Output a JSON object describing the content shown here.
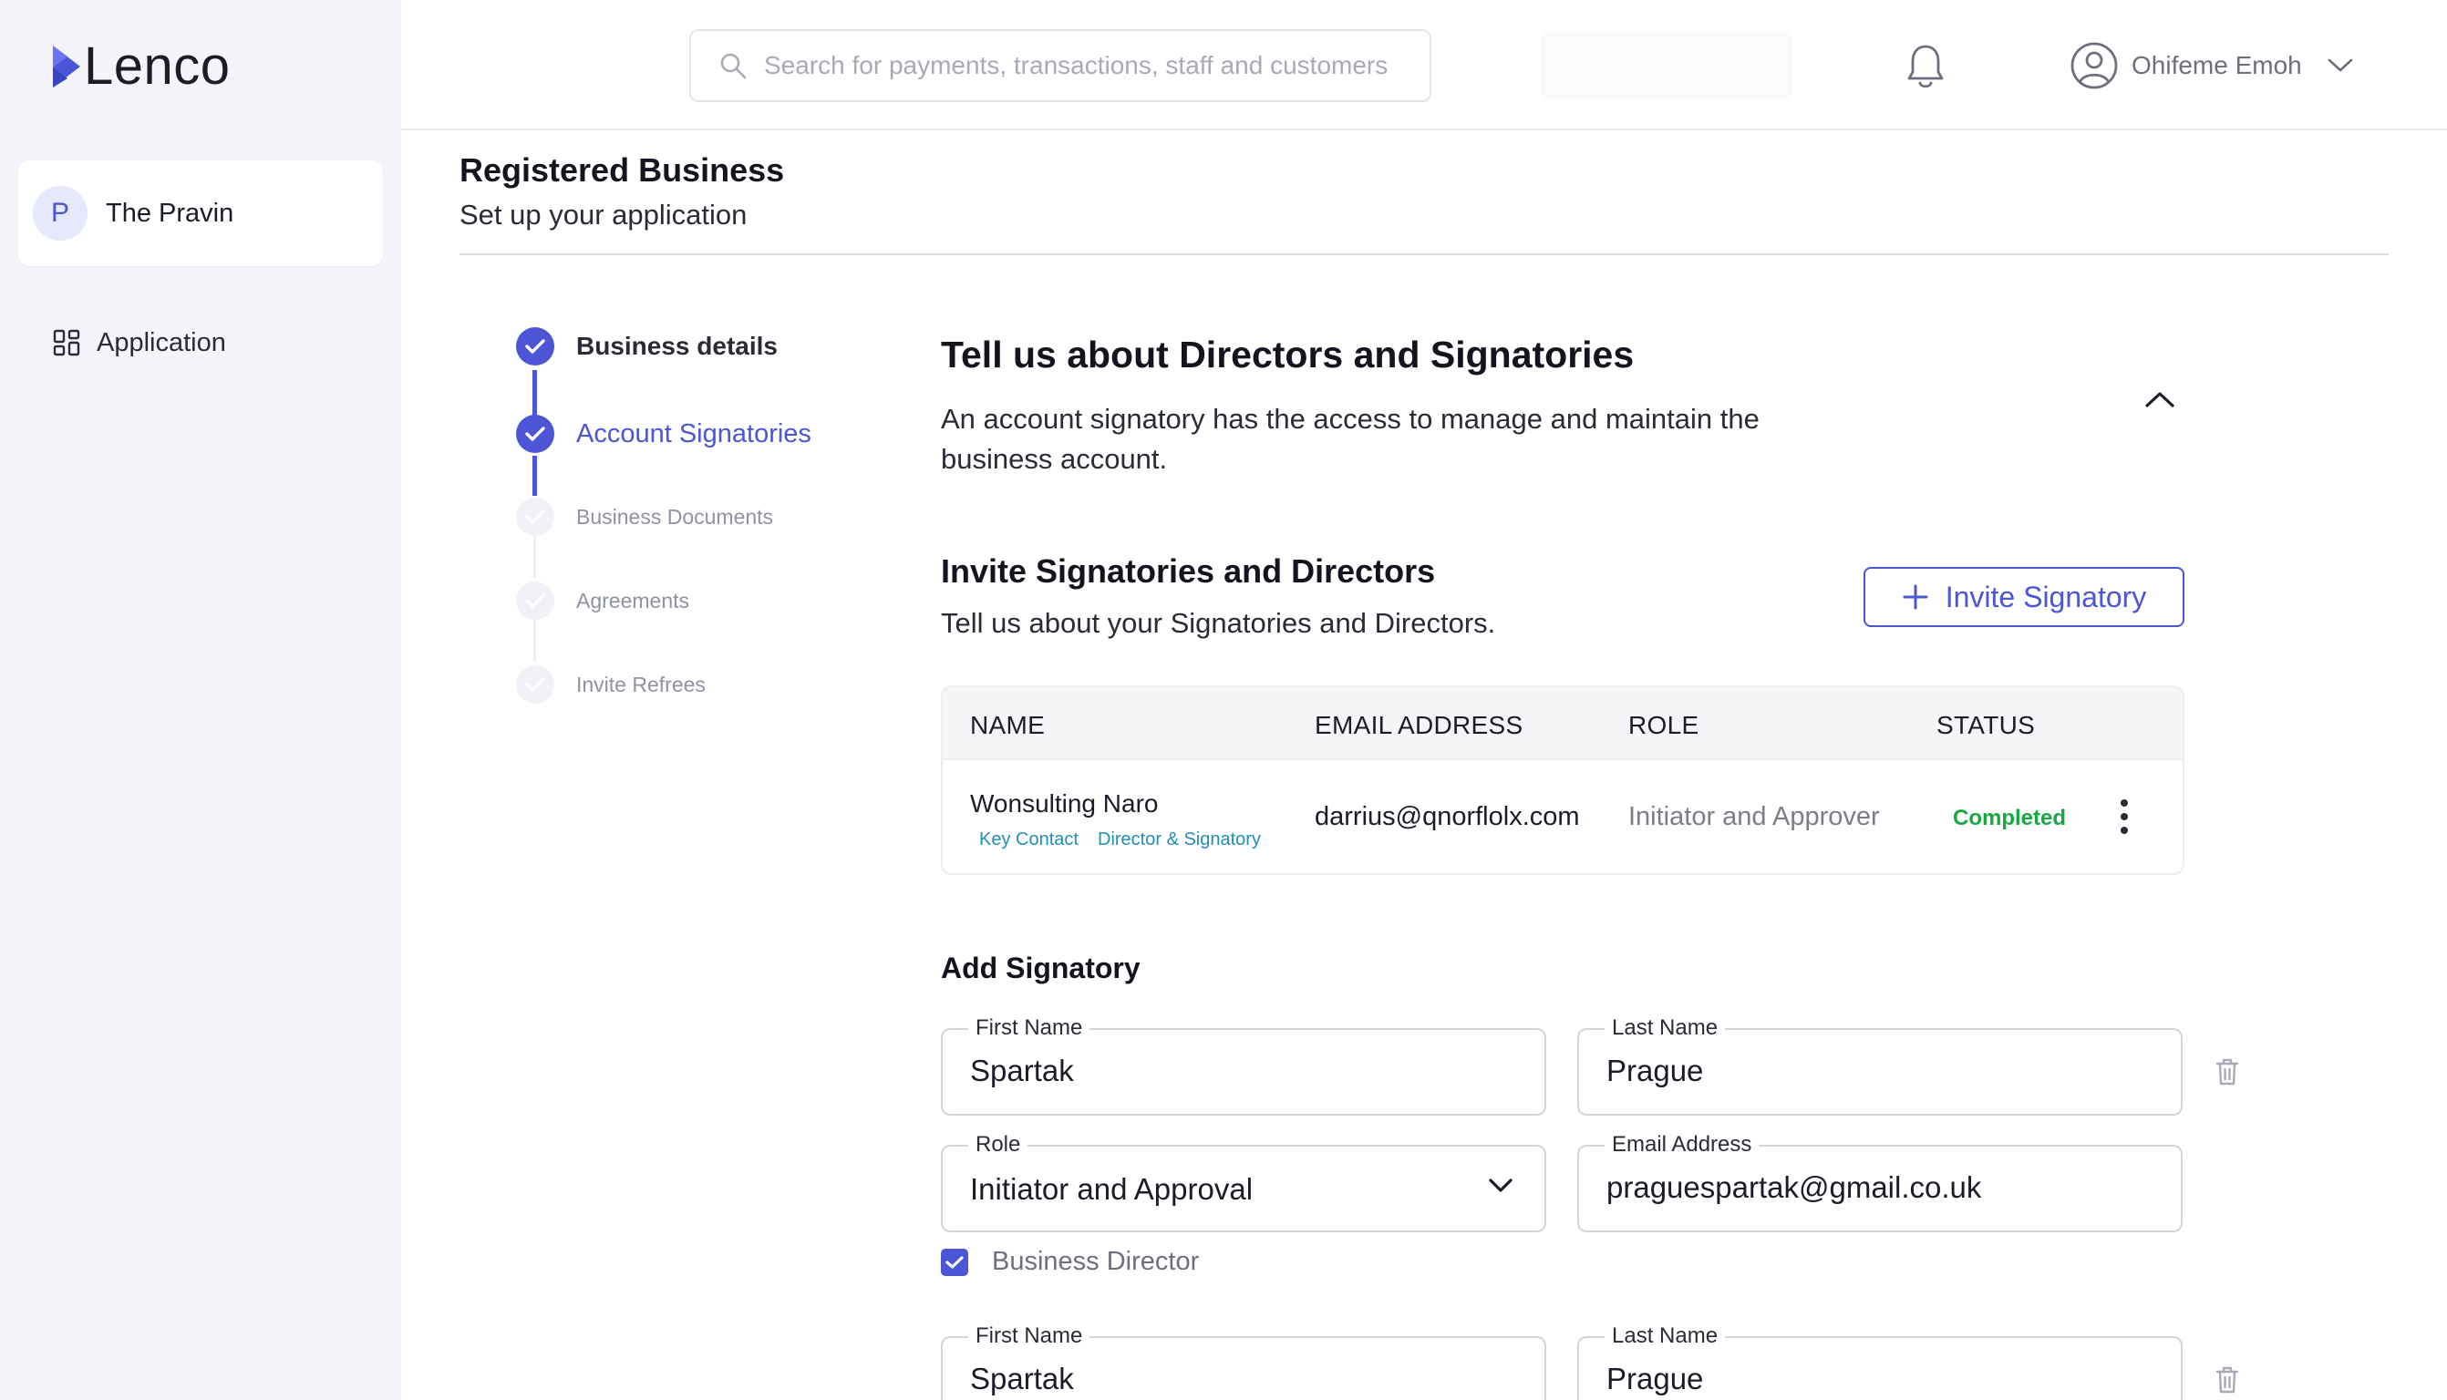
{
  "brand": {
    "name": "Lenco",
    "accent": "#4b55d6"
  },
  "sidebar": {
    "business": {
      "avatar_letter": "P",
      "name": "The Pravin"
    },
    "nav": [
      {
        "label": "Application",
        "icon": "grid-icon"
      }
    ]
  },
  "topbar": {
    "search_placeholder": "Search for payments, transactions, staff and customers",
    "user_name": "Ohifeme Emoh"
  },
  "page": {
    "title": "Registered Business",
    "subtitle": "Set up your application"
  },
  "steps": [
    {
      "label": "Business details",
      "state": "done"
    },
    {
      "label": "Account Signatories",
      "state": "active"
    },
    {
      "label": "Business Documents",
      "state": "todo"
    },
    {
      "label": "Agreements",
      "state": "todo"
    },
    {
      "label": "Invite Refrees",
      "state": "todo"
    }
  ],
  "section": {
    "title": "Tell us about Directors and Signatories",
    "description": "An account signatory has the access to manage and maintain the business account."
  },
  "invite": {
    "title": "Invite Signatories and Directors",
    "subtitle": "Tell us about your Signatories and Directors.",
    "button_label": "Invite Signatory"
  },
  "table": {
    "columns": [
      "NAME",
      "EMAIL ADDRESS",
      "ROLE",
      "STATUS"
    ],
    "rows": [
      {
        "name": "Wonsulting Naro",
        "tags": [
          "Key Contact",
          "Director & Signatory"
        ],
        "email": "darrius@qnorflolx.com",
        "role": "Initiator and Approver",
        "status": "Completed",
        "status_color": "#18a843"
      }
    ]
  },
  "add_signatory": {
    "title": "Add Signatory",
    "labels": {
      "first_name": "First Name",
      "last_name": "Last Name",
      "role": "Role",
      "email": "Email Address"
    },
    "entries": [
      {
        "first_name": "Spartak",
        "last_name": "Prague",
        "role": "Initiator and Approval",
        "email": "praguespartak@gmail.co.uk",
        "business_director_label": "Business Director",
        "business_director_checked": true
      },
      {
        "first_name": "Spartak",
        "last_name": "Prague"
      }
    ]
  }
}
